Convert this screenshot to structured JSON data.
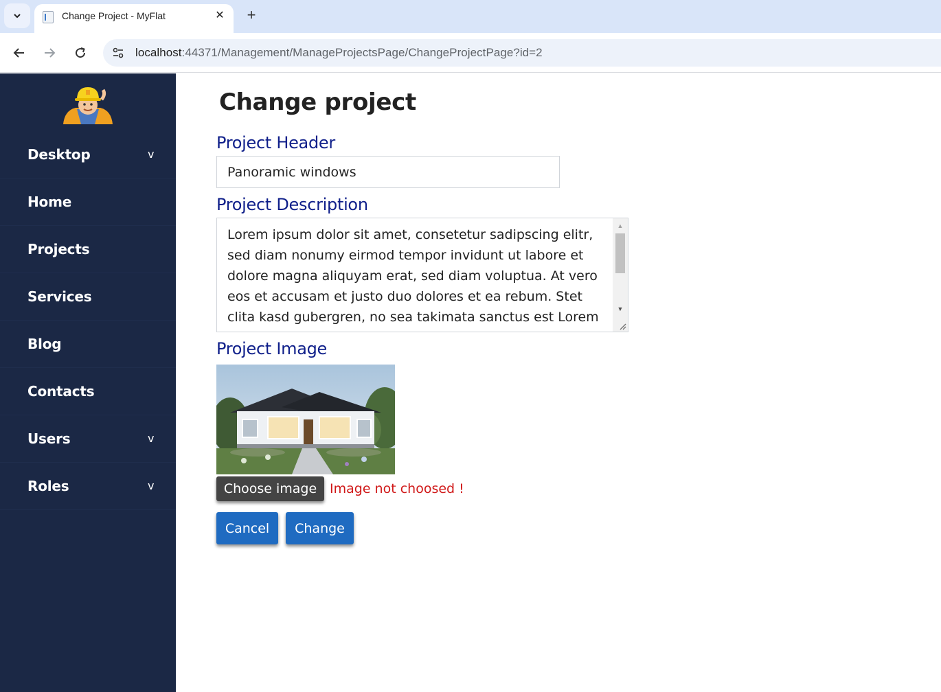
{
  "browser": {
    "tab_title": "Change Project - MyFlat",
    "url_host": "localhost",
    "url_path": ":44371/Management/ManageProjectsPage/ChangeProjectPage?id=2",
    "close_glyph": "✕",
    "newtab_glyph": "+"
  },
  "sidebar": {
    "items": [
      {
        "label": "Desktop",
        "chevron": "v"
      },
      {
        "label": "Home",
        "chevron": ""
      },
      {
        "label": "Projects",
        "chevron": ""
      },
      {
        "label": "Services",
        "chevron": ""
      },
      {
        "label": "Blog",
        "chevron": ""
      },
      {
        "label": "Contacts",
        "chevron": ""
      },
      {
        "label": "Users",
        "chevron": "v"
      },
      {
        "label": "Roles",
        "chevron": "v"
      }
    ]
  },
  "page": {
    "title": "Change project",
    "header_label": "Project Header",
    "header_value": "Panoramic windows",
    "description_label": "Project Description",
    "description_value": "Lorem ipsum dolor sit amet, consetetur sadipscing elitr, sed diam nonumy eirmod tempor invidunt ut labore et dolore magna aliquyam erat, sed diam voluptua. At vero eos et accusam et justo duo dolores et ea rebum. Stet clita kasd gubergren, no sea takimata sanctus est Lorem ipsum dolor sit amet.",
    "image_label": "Project Image",
    "choose_image_label": "Choose image",
    "image_error": "Image not choosed !",
    "cancel_label": "Cancel",
    "change_label": "Change"
  },
  "colors": {
    "sidebar_bg": "#1b2845",
    "label_blue": "#0f1f8a",
    "primary_button": "#1f6bc1",
    "error_red": "#d01818"
  }
}
